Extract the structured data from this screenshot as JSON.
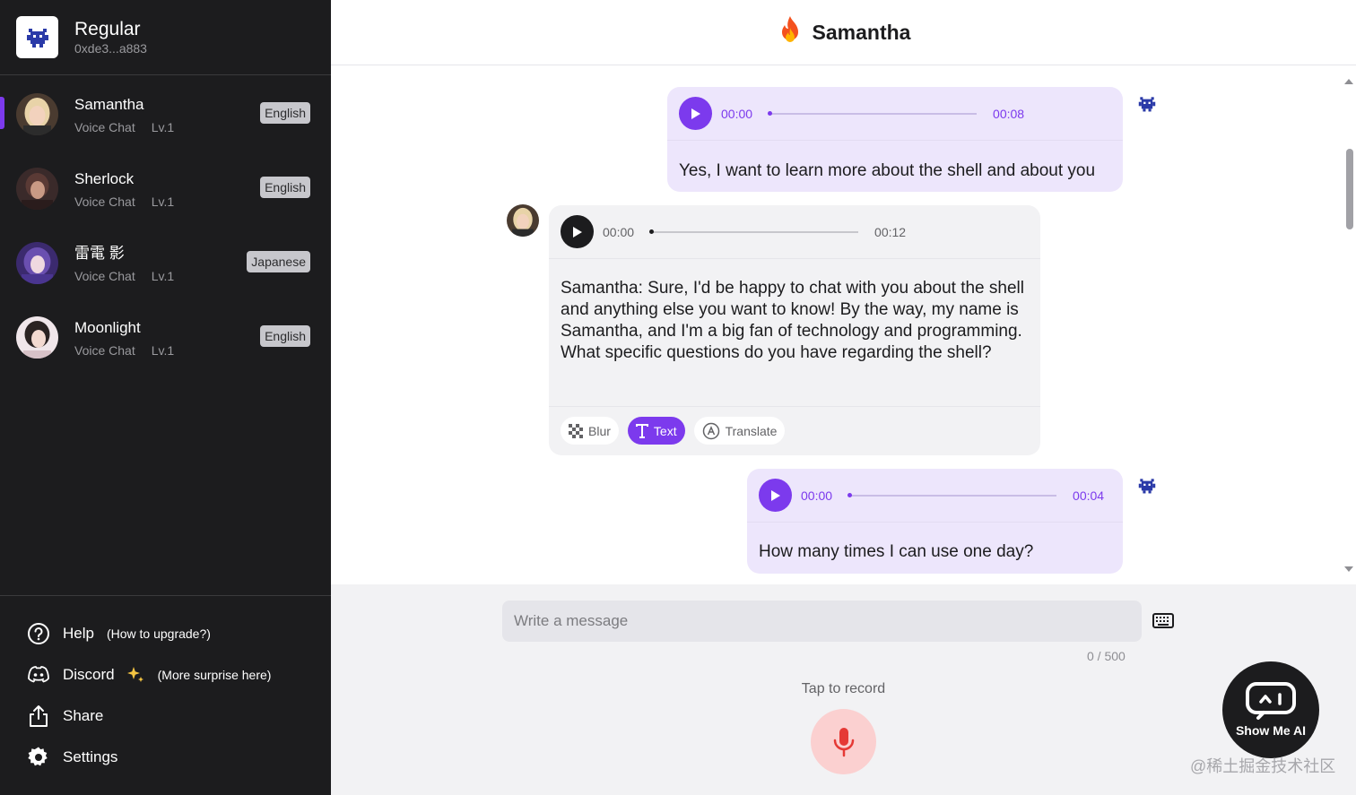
{
  "user": {
    "name": "Regular",
    "address": "0xde3...a883"
  },
  "characters": [
    {
      "name": "Samantha",
      "mode": "Voice Chat",
      "level": "Lv.1",
      "language": "English",
      "active": true
    },
    {
      "name": "Sherlock",
      "mode": "Voice Chat",
      "level": "Lv.1",
      "language": "English",
      "active": false
    },
    {
      "name": "雷電 影",
      "mode": "Voice Chat",
      "level": "Lv.1",
      "language": "Japanese",
      "active": false
    },
    {
      "name": "Moonlight",
      "mode": "Voice Chat",
      "level": "Lv.1",
      "language": "English",
      "active": false
    }
  ],
  "sidebar_links": {
    "help": {
      "label": "Help",
      "note": "(How to upgrade?)"
    },
    "discord": {
      "label": "Discord",
      "note": "(More surprise here)"
    },
    "share": {
      "label": "Share"
    },
    "settings": {
      "label": "Settings"
    }
  },
  "header": {
    "title": "Samantha",
    "icon": "fire-emoji"
  },
  "messages": [
    {
      "role": "user",
      "start": "00:00",
      "duration": "00:08",
      "text": "Yes, I want to learn more about the shell and about you"
    },
    {
      "role": "bot",
      "start": "00:00",
      "duration": "00:12",
      "text": "Samantha: Sure, I'd be happy to chat with you about the shell and anything else you want to know! By the way, my name is Samantha, and I'm a big fan of technology and programming. What specific questions do you have regarding the shell?",
      "actions": {
        "blur": "Blur",
        "text": "Text",
        "translate": "Translate"
      }
    },
    {
      "role": "user",
      "start": "00:00",
      "duration": "00:04",
      "text": "How many times I can use one day?"
    }
  ],
  "composer": {
    "placeholder": "Write a message",
    "counter": "0 / 500",
    "record_label": "Tap to record"
  },
  "badge": {
    "text": "Show Me AI"
  },
  "watermark": "@稀土掘金技术社区",
  "colors": {
    "accent": "#7c3aed",
    "sidebar_bg": "#1c1c1e",
    "mic_bg": "#fbd0d0",
    "mic_icon": "#e53935"
  }
}
